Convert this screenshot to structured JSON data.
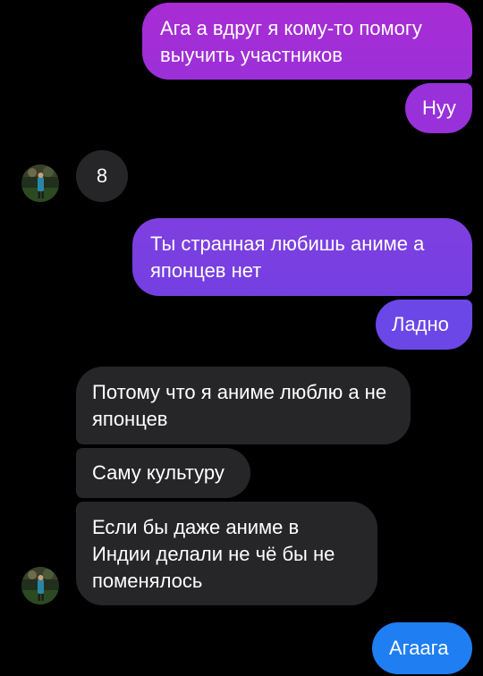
{
  "conversation": {
    "messages": [
      {
        "id": "m1",
        "sender": "me",
        "text": "Ага а вдруг я кому-то помогу выучить участников",
        "color": "#a12fd6"
      },
      {
        "id": "m2",
        "sender": "me",
        "text": "Нуу",
        "color": "#9a30d8"
      },
      {
        "id": "m3",
        "sender": "other",
        "text": "8"
      },
      {
        "id": "m4",
        "sender": "me",
        "text": "Ты странная любишь аниме а японцев нет",
        "color": "#7a40e0"
      },
      {
        "id": "m5",
        "sender": "me",
        "text": "Ладно",
        "color": "#6e46e6"
      },
      {
        "id": "m6",
        "sender": "other",
        "text": "Потому что я аниме люблю а не японцев"
      },
      {
        "id": "m7",
        "sender": "other",
        "text": "Саму культуру"
      },
      {
        "id": "m8",
        "sender": "other",
        "text": "Если бы даже аниме в Индии делали не чё бы не поменялось"
      },
      {
        "id": "m9",
        "sender": "me",
        "text": "Агаага",
        "color": "#1f7ef2"
      }
    ]
  },
  "colors": {
    "background": "#000000",
    "incoming_bubble": "#262629",
    "outgoing_gradient_top": "#b22cd2",
    "outgoing_gradient_bottom": "#1f7ef2"
  },
  "avatar": {
    "icon": "user-avatar-icon"
  }
}
